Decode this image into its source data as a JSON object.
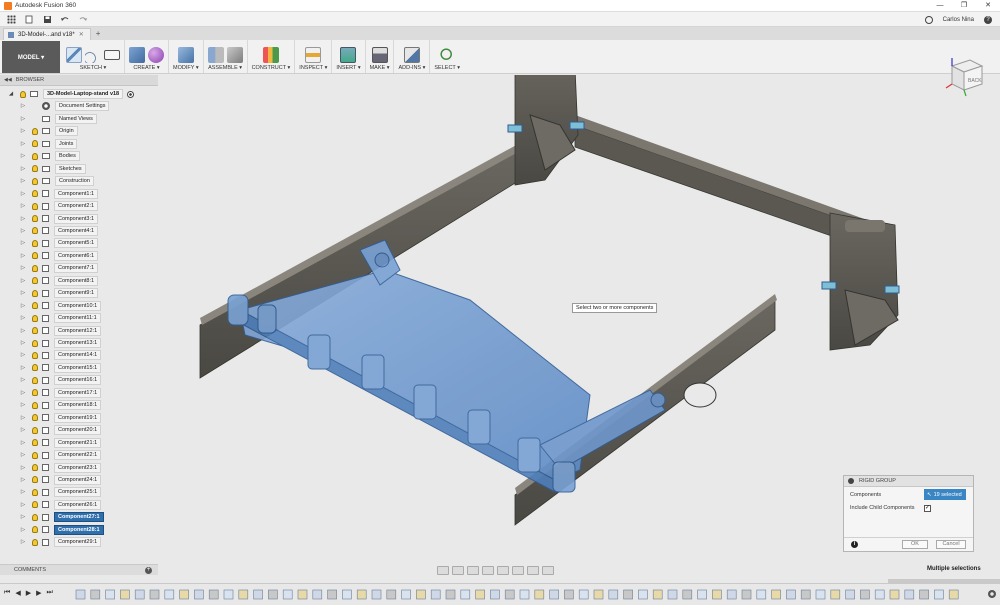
{
  "window": {
    "title": "Autodesk Fusion 360",
    "controls": [
      "—",
      "❐",
      "✕"
    ]
  },
  "quick_access": {
    "user": "Carlos Nina",
    "help": "?"
  },
  "doc_tab": {
    "label": "3D-Model-...and v18*",
    "close": "✕",
    "add": "+"
  },
  "toolbar": {
    "workspace": "MODEL ▾",
    "groups": [
      {
        "label": "SKETCH ▾"
      },
      {
        "label": "CREATE ▾"
      },
      {
        "label": "MODIFY ▾"
      },
      {
        "label": "ASSEMBLE ▾"
      },
      {
        "label": "CONSTRUCT ▾"
      },
      {
        "label": "INSPECT ▾"
      },
      {
        "label": "INSERT ▾"
      },
      {
        "label": "MAKE ▾"
      },
      {
        "label": "ADD-INS ▾"
      },
      {
        "label": "SELECT ▾"
      }
    ]
  },
  "browser": {
    "title": "BROWSER",
    "root": "3D-Model-Laptop-stand v18",
    "items": [
      {
        "label": "Document Settings",
        "type": "gear"
      },
      {
        "label": "Named Views",
        "type": "folder"
      },
      {
        "label": "Origin",
        "type": "folder"
      },
      {
        "label": "Joints",
        "type": "folder"
      },
      {
        "label": "Bodies",
        "type": "folder"
      },
      {
        "label": "Sketches",
        "type": "folder"
      },
      {
        "label": "Construction",
        "type": "folder"
      },
      {
        "label": "Component1:1",
        "type": "comp"
      },
      {
        "label": "Component2:1",
        "type": "comp"
      },
      {
        "label": "Component3:1",
        "type": "comp"
      },
      {
        "label": "Component4:1",
        "type": "comp"
      },
      {
        "label": "Component5:1",
        "type": "comp"
      },
      {
        "label": "Component6:1",
        "type": "comp"
      },
      {
        "label": "Component7:1",
        "type": "comp"
      },
      {
        "label": "Component8:1",
        "type": "comp"
      },
      {
        "label": "Component9:1",
        "type": "comp"
      },
      {
        "label": "Component10:1",
        "type": "comp"
      },
      {
        "label": "Component11:1",
        "type": "comp"
      },
      {
        "label": "Component12:1",
        "type": "comp"
      },
      {
        "label": "Component13:1",
        "type": "comp"
      },
      {
        "label": "Component14:1",
        "type": "comp"
      },
      {
        "label": "Component15:1",
        "type": "comp"
      },
      {
        "label": "Component16:1",
        "type": "comp"
      },
      {
        "label": "Component17:1",
        "type": "comp"
      },
      {
        "label": "Component18:1",
        "type": "comp"
      },
      {
        "label": "Component19:1",
        "type": "comp"
      },
      {
        "label": "Component20:1",
        "type": "comp"
      },
      {
        "label": "Component21:1",
        "type": "comp"
      },
      {
        "label": "Component22:1",
        "type": "comp"
      },
      {
        "label": "Component23:1",
        "type": "comp"
      },
      {
        "label": "Component24:1",
        "type": "comp"
      },
      {
        "label": "Component25:1",
        "type": "comp"
      },
      {
        "label": "Component26:1",
        "type": "comp"
      },
      {
        "label": "Component27:1",
        "type": "comp",
        "selected": true
      },
      {
        "label": "Component28:1",
        "type": "comp",
        "selected": true
      },
      {
        "label": "Component29:1",
        "type": "comp"
      }
    ]
  },
  "comments": {
    "label": "COMMENTS",
    "add": "+"
  },
  "viewport": {
    "tooltip": "Select two or more components"
  },
  "viewcube": {
    "face": "BACK"
  },
  "dialog": {
    "title": "RIGID GROUP",
    "components_label": "Components",
    "selection_value": "19 selected",
    "include_child_label": "Include Child Components",
    "include_child_checked": "✓",
    "info": "i",
    "ok": "OK",
    "cancel": "Cancel"
  },
  "status": "Multiple selections",
  "timeline": {
    "controls": [
      "⏮",
      "◀",
      "▶",
      "▶",
      "⏭"
    ]
  },
  "colors": {
    "selection_blue": "#6f9bd0",
    "part_gray": "#57544e",
    "accent": "#2f6fab"
  }
}
